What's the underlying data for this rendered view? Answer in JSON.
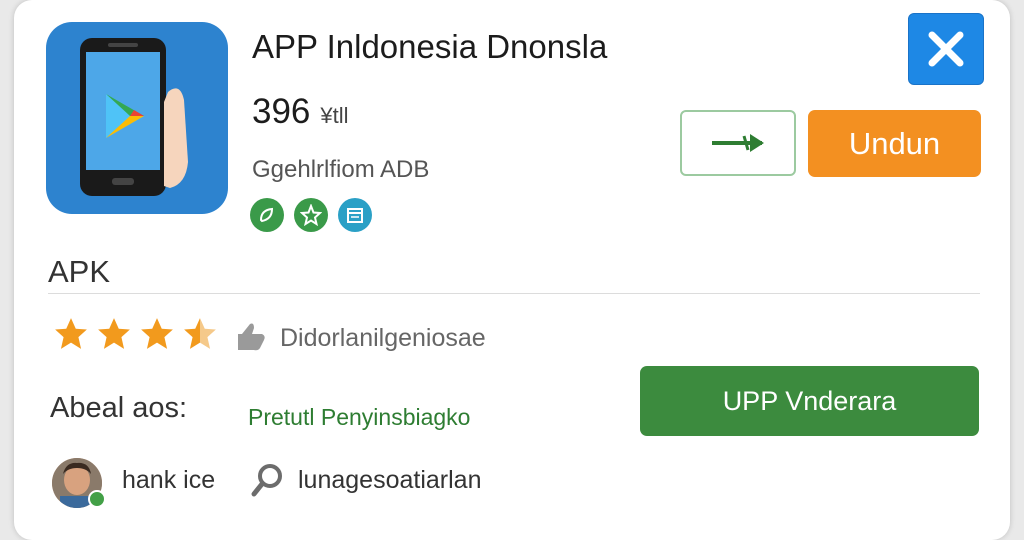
{
  "app": {
    "title": "APP Inldonesia Dnonsla",
    "size_value": "396",
    "size_unit": "¥tll",
    "developer": "Ggehlrlfiom ADB",
    "icon_name": "phone-play-store-icon",
    "badges": [
      {
        "icon": "leaf-badge-icon",
        "color": "#3a9a49"
      },
      {
        "icon": "star-badge-icon",
        "color": "#3a9a49"
      },
      {
        "icon": "calendar-badge-icon",
        "color": "#2aa0c6"
      }
    ]
  },
  "actions": {
    "close_icon": "close-icon",
    "share_icon": "share-arrow-icon",
    "download_label": "Undun",
    "install_label": "UPP Vnderara"
  },
  "section": {
    "apk_label": "APK"
  },
  "rating": {
    "stars": 3.5,
    "max": 5,
    "text": "Didorlanilgeniosae",
    "thumb_icon": "thumbs-up-icon"
  },
  "details": {
    "label": "Abeal aos:",
    "value": "Pretutl Penyinsbiagko"
  },
  "user": {
    "name": "hank ice",
    "avatar_icon": "avatar",
    "search_icon": "search-icon",
    "search_text": "lunagesoatiarlan"
  },
  "colors": {
    "accent_blue": "#1e88e5",
    "download_orange": "#f39021",
    "install_green": "#3c8b3e",
    "star_orange": "#f29a1d",
    "link_green": "#2e7d32"
  }
}
